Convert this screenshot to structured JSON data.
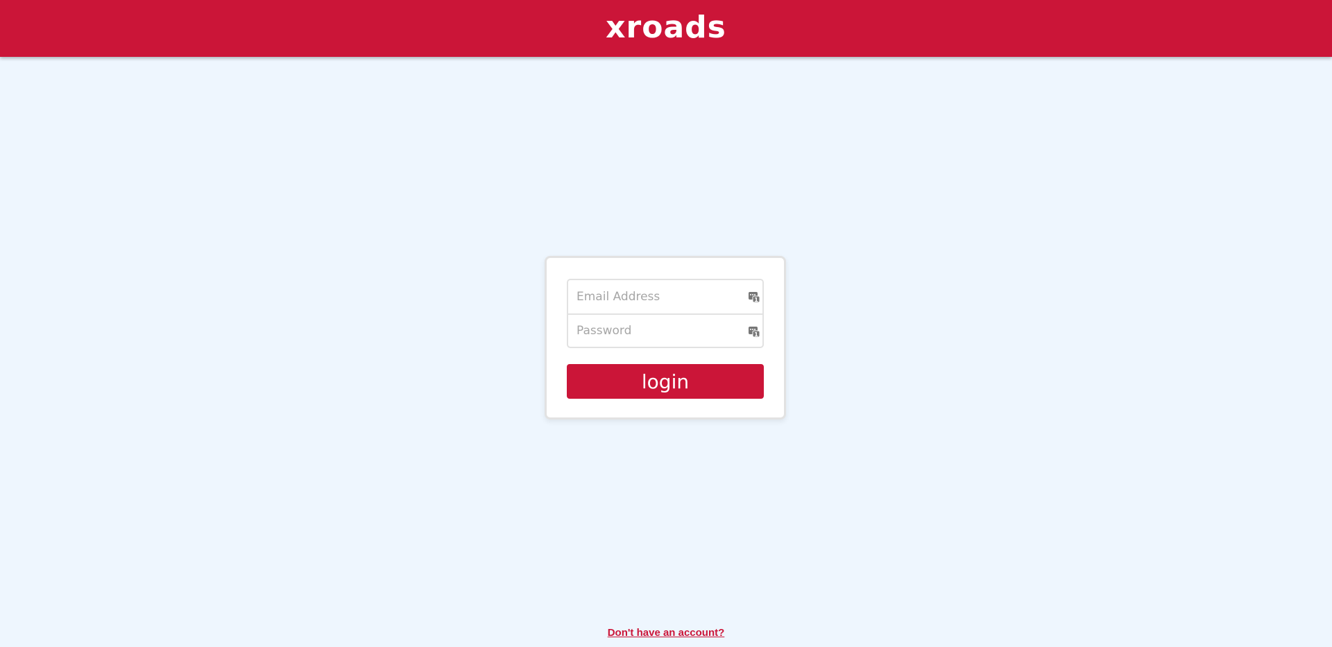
{
  "header": {
    "logo": "xroads",
    "brand_color": "#cb1538"
  },
  "login": {
    "email_placeholder": "Email Address",
    "email_value": "",
    "password_placeholder": "Password",
    "password_value": "",
    "field_icon": "password-manager-key-icon",
    "submit_label": "login"
  },
  "footer": {
    "signup_link": "Don't have an account?"
  }
}
